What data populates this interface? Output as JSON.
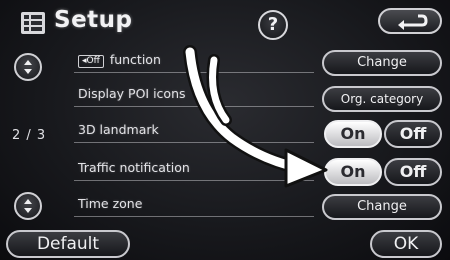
{
  "header": {
    "title": "Setup",
    "help_label": "?",
    "setup_icon": "setup-menu-icon",
    "back_icon": "return-arrow-icon"
  },
  "pager": {
    "current": "2 / 3"
  },
  "rows": [
    {
      "badge": "◂Off",
      "label": "function",
      "button": "Change"
    },
    {
      "label": "Display POI icons",
      "button": "Org. category"
    },
    {
      "label": "3D landmark",
      "on": "On",
      "off": "Off",
      "selected": "On"
    },
    {
      "label": "Traffic notification",
      "on": "On",
      "off": "Off",
      "selected": "On"
    },
    {
      "label": "Time zone",
      "button": "Change"
    }
  ],
  "footer": {
    "default_label": "Default",
    "ok_label": "OK"
  },
  "colors": {
    "background": "#1a1b1f",
    "text": "#e8e8ea",
    "active_button": "#f0f0f2",
    "arrow": "#ffffff"
  }
}
